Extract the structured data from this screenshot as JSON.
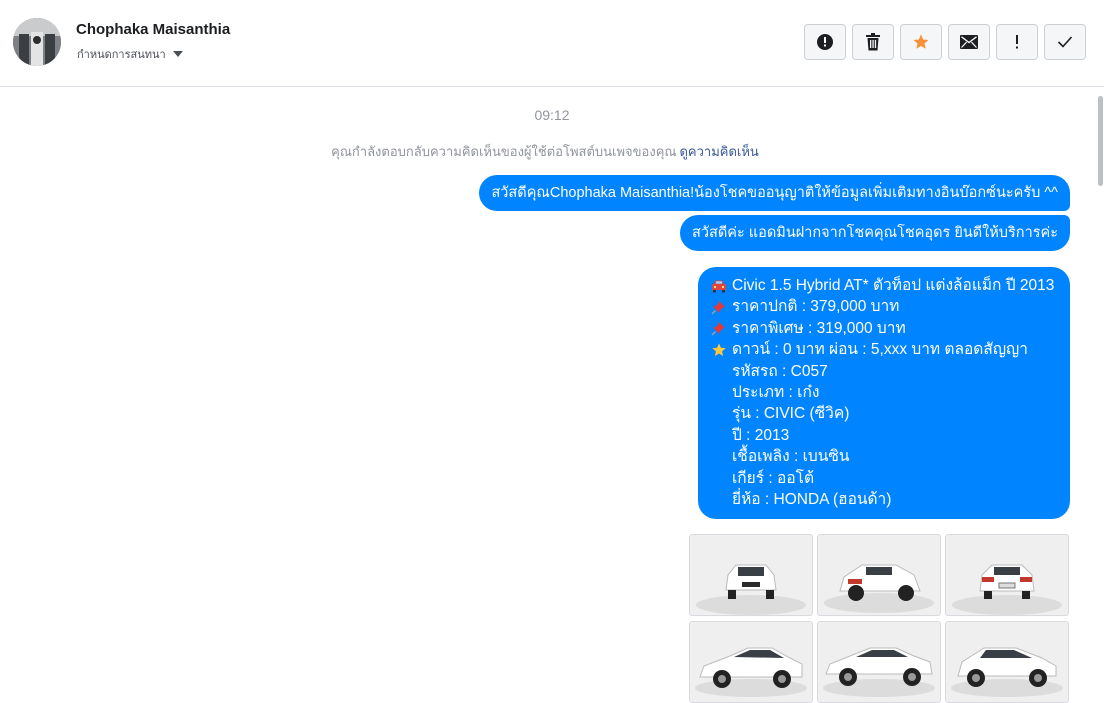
{
  "header": {
    "contact_name": "Chophaka Maisanthia",
    "assign_label": "กำหนดการสนทนา",
    "actions": [
      {
        "name": "mark-spam-button",
        "icon": "alert-circle-icon"
      },
      {
        "name": "delete-button",
        "icon": "trash-icon"
      },
      {
        "name": "star-button",
        "icon": "star-icon"
      },
      {
        "name": "mark-unread-button",
        "icon": "envelope-icon"
      },
      {
        "name": "follow-up-button",
        "icon": "exclamation-icon"
      },
      {
        "name": "mark-done-button",
        "icon": "check-icon"
      }
    ]
  },
  "conversation": {
    "timestamp": "09:12",
    "notice_text": "คุณกำลังตอบกลับความคิดเห็นของผู้ใช้ต่อโพสต์บนเพจของคุณ",
    "notice_link": "ดูความคิดเห็น",
    "messages": [
      "สวัสดีคุณChophaka Maisanthia!น้องโชคขออนุญาติให้ข้อมูลเพิ่มเติมทางอินบ๊อกซ์นะครับ ^^",
      "สวัสดีค่ะ แอดมินฝากจากโชคคุณโชคอุดร ยินดีให้บริการค่ะ"
    ],
    "car_message": {
      "title": "Civic 1.5 Hybrid AT* ตัวท็อป แต่งล้อแม็ก ปี 2013",
      "normal_price": "ราคาปกติ : 379,000 บาท",
      "special_price": "ราคาพิเศษ : 319,000 บาท",
      "down_payment": "ดาวน์ : 0 บาท ผ่อน : 5,xxx บาท ตลอดสัญญา",
      "code": "รหัสรถ : C057",
      "type": "ประเภท : เก๋ง",
      "model": "รุ่น : CIVIC (ซีวิค)",
      "year": "ปี : 2013",
      "fuel": "เชื้อเพลิง : เบนซิน",
      "gear": "เกียร์ : ออโต้",
      "brand": "ยี่ห้อ : HONDA (ฮอนด้า)"
    },
    "photos": [
      "car-front",
      "car-rear-left",
      "car-rear",
      "car-side-left",
      "car-side",
      "car-front-right"
    ]
  },
  "colors": {
    "bubble": "#0084ff",
    "star": "#f7923a"
  }
}
